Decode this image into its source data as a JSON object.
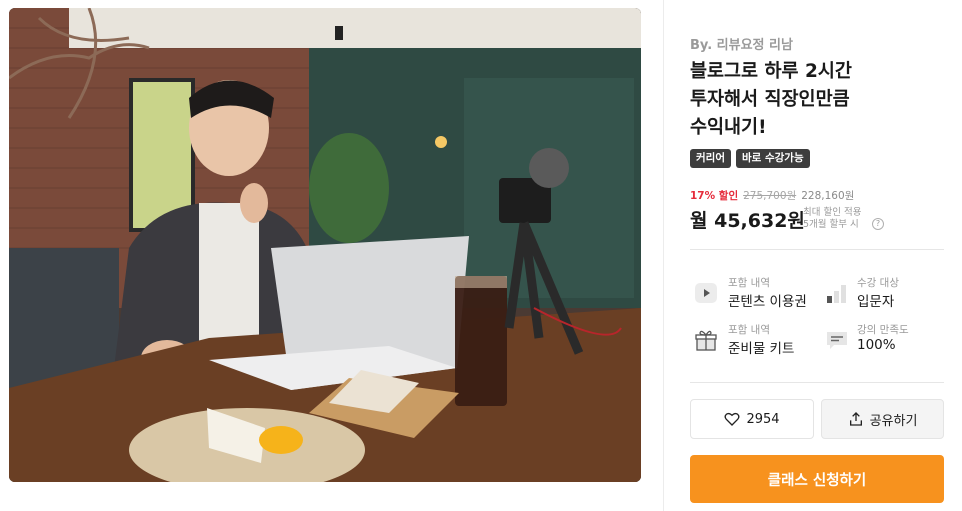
{
  "class": {
    "author": "By. 리뷰요정 리남",
    "title": "블로그로 하루 2시간\n투자해서 직장인만큼\n수익내기!",
    "tags": [
      "커리어",
      "바로 수강가능"
    ]
  },
  "pricing": {
    "discount": "17% 할인",
    "original_price": "275,700원",
    "sale_price": "228,160원",
    "monthly_price": "월 45,632원",
    "monthly_note": "최대 할인 적용\n5개월 할부 시"
  },
  "info": {
    "content": {
      "label": "포함 내역",
      "value": "콘텐츠 이용권",
      "icon": "play-icon"
    },
    "level": {
      "label": "수강 대상",
      "value": "입문자",
      "icon": "bar-level-icon"
    },
    "kit": {
      "label": "포함 내역",
      "value": "준비물 키트",
      "icon": "gift-icon"
    },
    "satisfaction": {
      "label": "강의 만족도",
      "value": "100%",
      "icon": "comment-icon"
    }
  },
  "actions": {
    "like_count": "2954",
    "share_label": "공유하기",
    "cta_label": "클래스 신청하기"
  },
  "colors": {
    "accent": "#f7921e",
    "discount": "#e52b3b",
    "tag_bg": "#3d3d3d"
  }
}
